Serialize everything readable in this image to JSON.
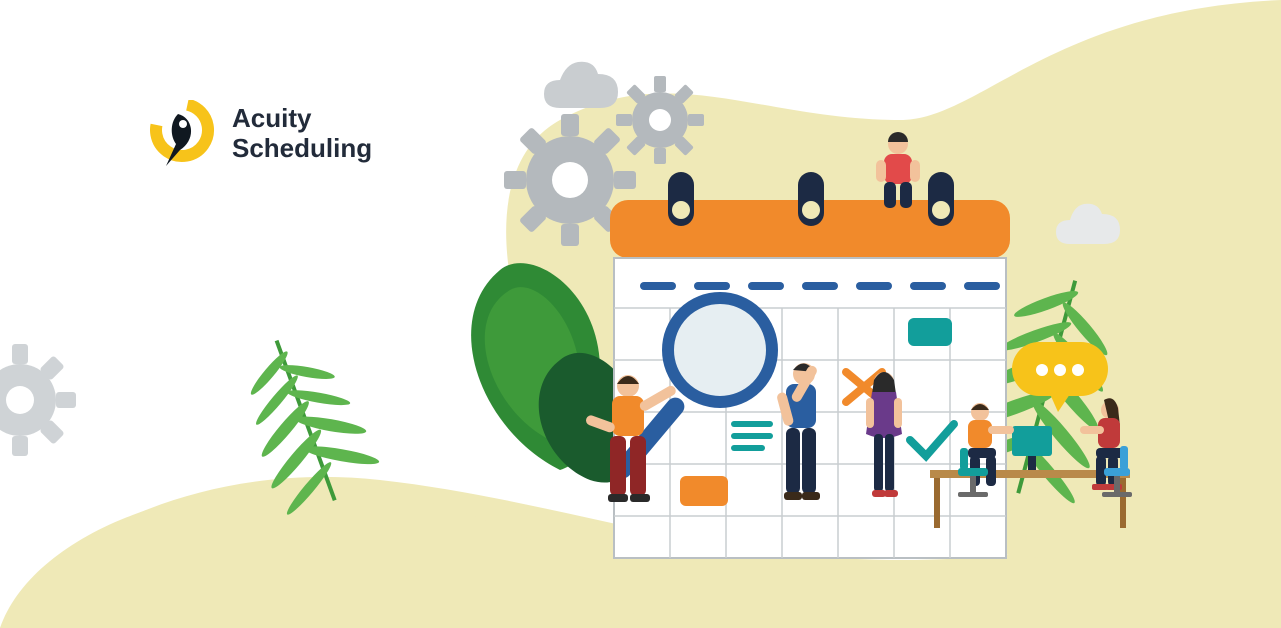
{
  "brand": {
    "line1": "Acuity",
    "line2": "Scheduling"
  },
  "palette": {
    "yellow": "#f7c31a",
    "orange": "#f18a2b",
    "navy": "#1c2a44",
    "cream": "#efe9b7",
    "teal": "#129e9b",
    "leaf": "#3e9a3a",
    "gray": "#b4b9bd",
    "blue": "#2a5ea0",
    "pantsRed": "#8f2626",
    "red": "#c03a3a",
    "darkGreen": "#1a5b2d"
  }
}
